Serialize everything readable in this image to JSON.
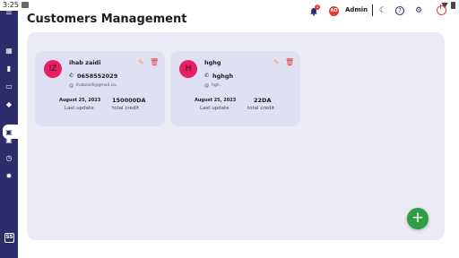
{
  "status_bar": {
    "time": "3:25"
  },
  "page": {
    "title": "Customers Management"
  },
  "topbar": {
    "notification_count": "1",
    "avatar_initials": "AD",
    "user_name": "Admin"
  },
  "customers": [
    {
      "initials": "IZ",
      "name": "ihab zaidi",
      "phone": "0658552029",
      "email": "ihabzaidi@gmail.co..",
      "last_update": "August 25, 2023",
      "last_update_label": "Last update",
      "total_credit": "150000DA",
      "total_credit_label": "total credit"
    },
    {
      "initials": "H",
      "name": "hghg",
      "phone": "hghgh",
      "email": "hgh..",
      "last_update": "August 25, 2023",
      "last_update_label": "Last update",
      "total_credit": "22DA",
      "total_credit_label": "total credit"
    }
  ],
  "fab": {
    "label": "+"
  },
  "icons": {
    "sidebar": [
      "menu-icon",
      "dashboard-icon",
      "shopping-bag-icon",
      "wallet-icon",
      "tag-icon",
      "customers-icon",
      "briefcase-icon",
      "history-icon",
      "settings-icon"
    ],
    "topbar": [
      "bell-icon",
      "dark-mode-icon",
      "help-icon",
      "gear-icon",
      "power-icon"
    ]
  },
  "colors": {
    "sidebar": "#2d2c6b",
    "panel": "#ebebf6",
    "card": "#e0e0f4",
    "avatar": "#e91e63",
    "danger": "#e53935",
    "edit": "#f5a623",
    "fab": "#2e9e44"
  }
}
